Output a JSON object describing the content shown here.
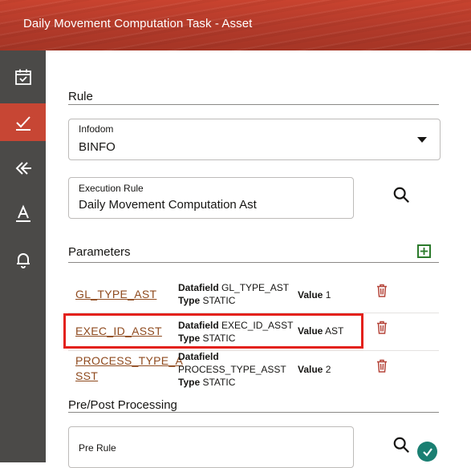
{
  "window": {
    "title": "Daily Movement Computation Task - Asset"
  },
  "sidebar": {
    "items": [
      {
        "name": "calendar-check-icon",
        "active": false
      },
      {
        "name": "checkmark-icon",
        "active": true
      },
      {
        "name": "double-arrow-left-icon",
        "active": false
      },
      {
        "name": "text-format-icon",
        "active": false
      },
      {
        "name": "bell-icon",
        "active": false
      }
    ]
  },
  "rule": {
    "section_title": "Rule",
    "infodom": {
      "label": "Infodom",
      "value": "BINFO"
    },
    "execution_rule": {
      "label": "Execution Rule",
      "value": "Daily Movement Computation Ast"
    }
  },
  "parameters": {
    "section_title": "Parameters",
    "datafield_label": "Datafield",
    "type_label": "Type",
    "value_label": "Value",
    "rows": [
      {
        "name": "GL_TYPE_AST",
        "name_lines": [
          "GL_TYPE_AST"
        ],
        "datafield": "GL_TYPE_AST",
        "type": "STATIC",
        "value": "1"
      },
      {
        "name": "EXEC_ID_ASST",
        "name_lines": [
          "EXEC_ID_ASST"
        ],
        "datafield": "EXEC_ID_ASST",
        "type": "STATIC",
        "value": "AST"
      },
      {
        "name": "PROCESS_TYPE_ASST",
        "name_lines": [
          "PROCESS_TYPE_A",
          "SST"
        ],
        "datafield": "PROCESS_TYPE_ASST",
        "type": "STATIC",
        "value": "2"
      }
    ]
  },
  "pre_post": {
    "section_title": "Pre/Post Processing",
    "pre_rule": {
      "label": "Pre Rule",
      "value": ""
    }
  },
  "colors": {
    "header": "#b23a2a",
    "active_nav": "#c74634",
    "sidebar": "#4b4a48",
    "link": "#8f4a1e",
    "highlight": "#e3211b",
    "add_button": "#2b7a2b",
    "status_ok": "#1a7f72"
  }
}
